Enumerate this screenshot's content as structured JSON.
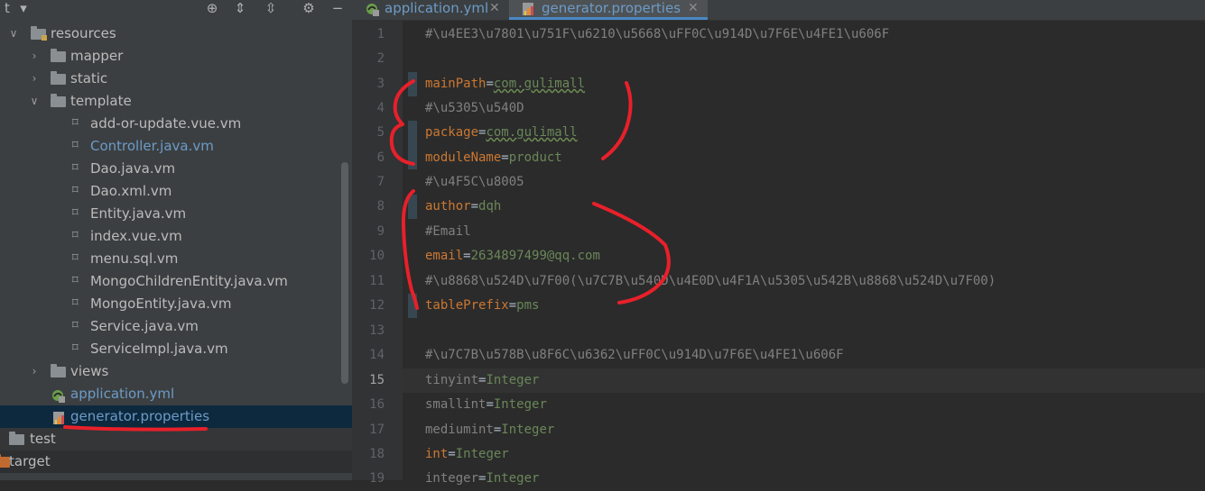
{
  "project": {
    "tree": [
      {
        "label": "resources",
        "icon": "resources-folder-icon",
        "expanded": true
      },
      {
        "label": "mapper",
        "icon": "folder-icon",
        "expanded": false
      },
      {
        "label": "static",
        "icon": "folder-icon",
        "expanded": false
      },
      {
        "label": "template",
        "icon": "folder-icon",
        "expanded": true
      },
      {
        "label": "add-or-update.vue.vm",
        "icon": "velocity-file-icon"
      },
      {
        "label": "Controller.java.vm",
        "icon": "velocity-file-icon"
      },
      {
        "label": "Dao.java.vm",
        "icon": "velocity-file-icon"
      },
      {
        "label": "Dao.xml.vm",
        "icon": "velocity-file-icon"
      },
      {
        "label": "Entity.java.vm",
        "icon": "velocity-file-icon"
      },
      {
        "label": "index.vue.vm",
        "icon": "velocity-file-icon"
      },
      {
        "label": "menu.sql.vm",
        "icon": "velocity-file-icon"
      },
      {
        "label": "MongoChildrenEntity.java.vm",
        "icon": "velocity-file-icon"
      },
      {
        "label": "MongoEntity.java.vm",
        "icon": "velocity-file-icon"
      },
      {
        "label": "Service.java.vm",
        "icon": "velocity-file-icon"
      },
      {
        "label": "ServiceImpl.java.vm",
        "icon": "velocity-file-icon"
      },
      {
        "label": "views",
        "icon": "folder-icon",
        "expanded": false
      },
      {
        "label": "application.yml",
        "icon": "yaml-file-icon"
      },
      {
        "label": "generator.properties",
        "icon": "properties-file-icon"
      },
      {
        "label": "test",
        "icon": "folder-icon"
      },
      {
        "label": "target",
        "icon": "excluded-folder-icon"
      }
    ]
  },
  "editor": {
    "tabs": [
      {
        "label": "application.yml",
        "icon": "yaml-file-icon",
        "active": false
      },
      {
        "label": "generator.properties",
        "icon": "properties-file-icon",
        "active": true
      }
    ],
    "current_line": 15,
    "lines": [
      {
        "n": "1",
        "comment": "#\\u4EE3\\u7801\\u751F\\u6210\\u5668\\uFF0C\\u914D\\u7F6E\\u4FE1\\u606F"
      },
      {
        "n": "2"
      },
      {
        "n": "3",
        "key": "mainPath",
        "value": "com.gulimall"
      },
      {
        "n": "4",
        "comment": "#\\u5305\\u540D"
      },
      {
        "n": "5",
        "key": "package",
        "value": "com.gulimall"
      },
      {
        "n": "6",
        "key": "moduleName",
        "value": "product"
      },
      {
        "n": "7",
        "comment": "#\\u4F5C\\u8005"
      },
      {
        "n": "8",
        "key": "author",
        "value": "dqh"
      },
      {
        "n": "9",
        "comment": "#Email"
      },
      {
        "n": "10",
        "key": "email",
        "value": "2634897499@qq.com"
      },
      {
        "n": "11",
        "comment": "#\\u8868\\u524D\\u7F00(\\u7C7B\\u540D\\u4E0D\\u4F1A\\u5305\\u542B\\u8868\\u524D\\u7F00)"
      },
      {
        "n": "12",
        "key": "tablePrefix",
        "value": "pms"
      },
      {
        "n": "13"
      },
      {
        "n": "14",
        "comment": "#\\u7C7B\\u578B\\u8F6C\\u6362\\uFF0C\\u914D\\u7F6E\\u4FE1\\u606F"
      },
      {
        "n": "15",
        "key": "tinyint",
        "value": "Integer",
        "muted": true
      },
      {
        "n": "16",
        "key": "smallint",
        "value": "Integer",
        "muted": true
      },
      {
        "n": "17",
        "key": "mediumint",
        "value": "Integer",
        "muted": true
      },
      {
        "n": "18",
        "key": "int",
        "value": "Integer"
      },
      {
        "n": "19",
        "key": "integer",
        "value": "Integer",
        "muted": true
      }
    ]
  },
  "colors": {
    "background": "#2b2b2b",
    "panel": "#3c3f41",
    "key": "#cc7832",
    "value": "#6a8759",
    "comment": "#808080",
    "selection": "#0d293e",
    "annotation": "#e8202a"
  }
}
